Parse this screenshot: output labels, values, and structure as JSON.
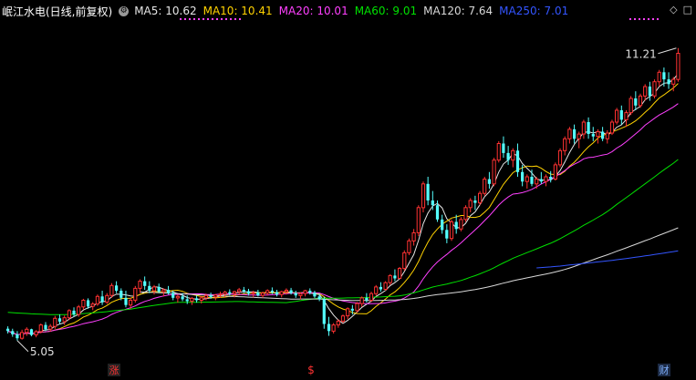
{
  "legend": {
    "title": "岷江水电(日线,前复权)",
    "ma5": "MA5: 10.62",
    "ma10": "MA10: 10.41",
    "ma20": "MA20: 10.01",
    "ma60": "MA60: 9.01",
    "ma120": "MA120: 7.64",
    "ma250": "MA250: 7.01"
  },
  "icons": {
    "diamond": "◇",
    "fullscreen": "□"
  },
  "colors": {
    "bg": "#000000",
    "up": "#ff3232",
    "down": "#54ffff",
    "ma5": "#e6e6e6",
    "ma10": "#ffd200",
    "ma20": "#ff40ff",
    "ma60": "#00e100",
    "ma120": "#d8d8d8",
    "ma250": "#3355ff"
  },
  "markers": {
    "zhang": "涨",
    "s": "$",
    "cai": "财"
  },
  "chart_data": {
    "type": "candlestick",
    "title": "岷江水电(日线,前复权)",
    "ylim": [
      4.7,
      11.8
    ],
    "annotations": [
      {
        "text": "11.21",
        "value": 11.21,
        "kind": "high"
      },
      {
        "text": "5.05",
        "value": 5.05,
        "kind": "low"
      }
    ],
    "ohlc": [
      [
        5.3,
        5.35,
        5.2,
        5.25
      ],
      [
        5.25,
        5.3,
        5.13,
        5.18
      ],
      [
        5.18,
        5.25,
        5.05,
        5.1
      ],
      [
        5.1,
        5.28,
        5.07,
        5.22
      ],
      [
        5.22,
        5.33,
        5.15,
        5.29
      ],
      [
        5.29,
        5.3,
        5.14,
        5.17
      ],
      [
        5.17,
        5.27,
        5.12,
        5.24
      ],
      [
        5.24,
        5.41,
        5.2,
        5.38
      ],
      [
        5.38,
        5.44,
        5.25,
        5.29
      ],
      [
        5.29,
        5.4,
        5.24,
        5.35
      ],
      [
        5.35,
        5.57,
        5.3,
        5.52
      ],
      [
        5.52,
        5.6,
        5.4,
        5.45
      ],
      [
        5.45,
        5.58,
        5.38,
        5.53
      ],
      [
        5.53,
        5.71,
        5.48,
        5.68
      ],
      [
        5.68,
        5.75,
        5.55,
        5.6
      ],
      [
        5.6,
        5.8,
        5.55,
        5.76
      ],
      [
        5.76,
        5.93,
        5.7,
        5.9
      ],
      [
        5.9,
        5.94,
        5.72,
        5.77
      ],
      [
        5.77,
        5.86,
        5.69,
        5.82
      ],
      [
        5.82,
        6.02,
        5.78,
        5.98
      ],
      [
        5.98,
        6.1,
        5.8,
        5.86
      ],
      [
        5.86,
        6.05,
        5.82,
        6.0
      ],
      [
        6.0,
        6.26,
        5.95,
        6.21
      ],
      [
        6.21,
        6.3,
        6.05,
        6.1
      ],
      [
        6.1,
        6.15,
        5.9,
        5.95
      ],
      [
        5.95,
        6.1,
        5.75,
        5.8
      ],
      [
        5.8,
        5.95,
        5.72,
        5.9
      ],
      [
        5.9,
        6.2,
        5.85,
        6.15
      ],
      [
        6.15,
        6.34,
        6.05,
        6.3
      ],
      [
        6.3,
        6.4,
        6.12,
        6.2
      ],
      [
        6.2,
        6.3,
        6.05,
        6.1
      ],
      [
        6.1,
        6.22,
        6.02,
        6.18
      ],
      [
        6.18,
        6.25,
        6.05,
        6.08
      ],
      [
        6.08,
        6.15,
        5.98,
        6.12
      ],
      [
        6.12,
        6.2,
        6.02,
        6.05
      ],
      [
        6.05,
        6.1,
        5.9,
        5.95
      ],
      [
        5.95,
        6.02,
        5.85,
        5.98
      ],
      [
        5.98,
        6.05,
        5.88,
        5.92
      ],
      [
        5.92,
        6.0,
        5.82,
        5.88
      ],
      [
        5.88,
        5.97,
        5.8,
        5.94
      ],
      [
        5.94,
        6.0,
        5.85,
        5.9
      ],
      [
        5.9,
        5.99,
        5.83,
        5.95
      ],
      [
        5.95,
        6.04,
        5.9,
        6.0
      ],
      [
        6.0,
        6.06,
        5.93,
        5.97
      ],
      [
        5.97,
        6.03,
        5.9,
        6.01
      ],
      [
        6.01,
        6.08,
        5.95,
        6.03
      ],
      [
        6.03,
        6.1,
        5.97,
        6.07
      ],
      [
        6.07,
        6.13,
        6.0,
        6.04
      ],
      [
        6.04,
        6.1,
        5.96,
        6.08
      ],
      [
        6.08,
        6.16,
        6.02,
        6.12
      ],
      [
        6.12,
        6.18,
        6.05,
        6.09
      ],
      [
        6.09,
        6.14,
        6.0,
        6.04
      ],
      [
        6.04,
        6.1,
        5.96,
        6.06
      ],
      [
        6.06,
        6.12,
        5.98,
        6.0
      ],
      [
        6.0,
        6.08,
        5.95,
        6.05
      ],
      [
        6.05,
        6.13,
        6.0,
        6.1
      ],
      [
        6.1,
        6.17,
        6.03,
        6.07
      ],
      [
        6.07,
        6.12,
        5.98,
        6.02
      ],
      [
        6.02,
        6.1,
        5.96,
        6.08
      ],
      [
        6.08,
        6.15,
        6.02,
        6.11
      ],
      [
        6.11,
        6.16,
        6.02,
        6.05
      ],
      [
        6.05,
        6.1,
        5.95,
        6.0
      ],
      [
        6.0,
        6.07,
        5.92,
        6.04
      ],
      [
        6.04,
        6.12,
        5.98,
        6.1
      ],
      [
        6.1,
        6.15,
        6.02,
        6.06
      ],
      [
        6.06,
        6.1,
        5.95,
        5.98
      ],
      [
        5.98,
        6.04,
        5.88,
        5.92
      ],
      [
        5.92,
        5.97,
        5.3,
        5.4
      ],
      [
        5.4,
        5.55,
        5.15,
        5.25
      ],
      [
        5.25,
        5.42,
        5.2,
        5.38
      ],
      [
        5.38,
        5.5,
        5.32,
        5.46
      ],
      [
        5.46,
        5.6,
        5.42,
        5.57
      ],
      [
        5.57,
        5.75,
        5.5,
        5.72
      ],
      [
        5.72,
        5.8,
        5.6,
        5.68
      ],
      [
        5.68,
        5.86,
        5.64,
        5.83
      ],
      [
        5.83,
        5.98,
        5.76,
        5.95
      ],
      [
        5.95,
        6.05,
        5.85,
        5.9
      ],
      [
        5.9,
        6.08,
        5.86,
        6.04
      ],
      [
        6.04,
        6.22,
        6.0,
        6.18
      ],
      [
        6.18,
        6.28,
        6.08,
        6.13
      ],
      [
        6.13,
        6.3,
        6.1,
        6.27
      ],
      [
        6.27,
        6.45,
        6.22,
        6.42
      ],
      [
        6.42,
        6.55,
        6.3,
        6.36
      ],
      [
        6.36,
        6.6,
        6.34,
        6.57
      ],
      [
        6.57,
        6.95,
        6.52,
        6.9
      ],
      [
        6.9,
        7.2,
        6.85,
        7.15
      ],
      [
        7.15,
        7.4,
        7.05,
        7.32
      ],
      [
        7.32,
        7.9,
        7.25,
        7.85
      ],
      [
        7.85,
        8.4,
        7.75,
        8.35
      ],
      [
        8.35,
        8.5,
        7.9,
        8.0
      ],
      [
        8.0,
        8.2,
        7.8,
        7.9
      ],
      [
        7.9,
        8.0,
        7.55,
        7.6
      ],
      [
        7.6,
        7.7,
        7.3,
        7.38
      ],
      [
        7.38,
        7.5,
        7.1,
        7.2
      ],
      [
        7.2,
        7.6,
        7.15,
        7.55
      ],
      [
        7.55,
        7.7,
        7.3,
        7.4
      ],
      [
        7.4,
        7.65,
        7.35,
        7.6
      ],
      [
        7.6,
        7.9,
        7.55,
        7.85
      ],
      [
        7.85,
        8.05,
        7.75,
        8.0
      ],
      [
        8.0,
        8.1,
        7.8,
        7.95
      ],
      [
        7.95,
        8.2,
        7.9,
        8.15
      ],
      [
        8.15,
        8.5,
        8.1,
        8.45
      ],
      [
        8.45,
        8.6,
        8.25,
        8.35
      ],
      [
        8.35,
        8.9,
        8.3,
        8.85
      ],
      [
        8.85,
        9.25,
        8.8,
        9.2
      ],
      [
        9.2,
        9.35,
        8.9,
        9.0
      ],
      [
        9.0,
        9.15,
        8.75,
        8.85
      ],
      [
        8.85,
        9.1,
        8.7,
        9.05
      ],
      [
        9.05,
        9.2,
        8.5,
        8.6
      ],
      [
        8.6,
        8.75,
        8.3,
        8.4
      ],
      [
        8.4,
        8.55,
        8.25,
        8.5
      ],
      [
        8.5,
        8.65,
        8.3,
        8.35
      ],
      [
        8.35,
        8.5,
        8.25,
        8.45
      ],
      [
        8.45,
        8.6,
        8.35,
        8.4
      ],
      [
        8.4,
        8.55,
        8.3,
        8.5
      ],
      [
        8.5,
        8.62,
        8.38,
        8.45
      ],
      [
        8.45,
        8.8,
        8.42,
        8.75
      ],
      [
        8.75,
        9.1,
        8.7,
        9.05
      ],
      [
        9.05,
        9.35,
        8.95,
        9.3
      ],
      [
        9.3,
        9.55,
        9.2,
        9.5
      ],
      [
        9.5,
        9.6,
        9.2,
        9.3
      ],
      [
        9.3,
        9.45,
        9.1,
        9.4
      ],
      [
        9.4,
        9.7,
        9.3,
        9.65
      ],
      [
        9.65,
        9.75,
        9.3,
        9.4
      ],
      [
        9.4,
        9.55,
        9.25,
        9.35
      ],
      [
        9.35,
        9.5,
        9.2,
        9.45
      ],
      [
        9.45,
        9.55,
        9.25,
        9.3
      ],
      [
        9.3,
        9.48,
        9.2,
        9.42
      ],
      [
        9.42,
        9.7,
        9.38,
        9.65
      ],
      [
        9.65,
        9.95,
        9.6,
        9.9
      ],
      [
        9.9,
        10.0,
        9.6,
        9.7
      ],
      [
        9.7,
        9.9,
        9.55,
        9.85
      ],
      [
        9.85,
        10.2,
        9.8,
        10.15
      ],
      [
        10.15,
        10.3,
        9.9,
        10.0
      ],
      [
        10.0,
        10.25,
        9.95,
        10.2
      ],
      [
        10.2,
        10.45,
        10.1,
        10.4
      ],
      [
        10.4,
        10.5,
        10.1,
        10.2
      ],
      [
        10.2,
        10.55,
        10.15,
        10.5
      ],
      [
        10.5,
        10.75,
        10.4,
        10.7
      ],
      [
        10.7,
        10.8,
        10.4,
        10.55
      ],
      [
        10.55,
        10.7,
        10.35,
        10.45
      ],
      [
        10.45,
        10.6,
        10.3,
        10.55
      ],
      [
        10.55,
        11.21,
        10.5,
        11.1
      ]
    ],
    "ma_series": [
      {
        "name": "MA5",
        "color": "#e6e6e6",
        "value": 10.62
      },
      {
        "name": "MA10",
        "color": "#ffd200",
        "value": 10.41
      },
      {
        "name": "MA20",
        "color": "#ff40ff",
        "value": 10.01
      },
      {
        "name": "MA60",
        "color": "#00e100",
        "value": 9.01,
        "start": [
          5.55,
          5.4,
          5.25,
          5.9,
          6.2
        ]
      },
      {
        "name": "MA120",
        "color": "#d8d8d8",
        "value": 7.64,
        "start": [
          6.6,
          6.0
        ]
      },
      {
        "name": "MA250",
        "color": "#3355ff",
        "value": 7.01,
        "start": [
          6.7
        ]
      }
    ]
  }
}
